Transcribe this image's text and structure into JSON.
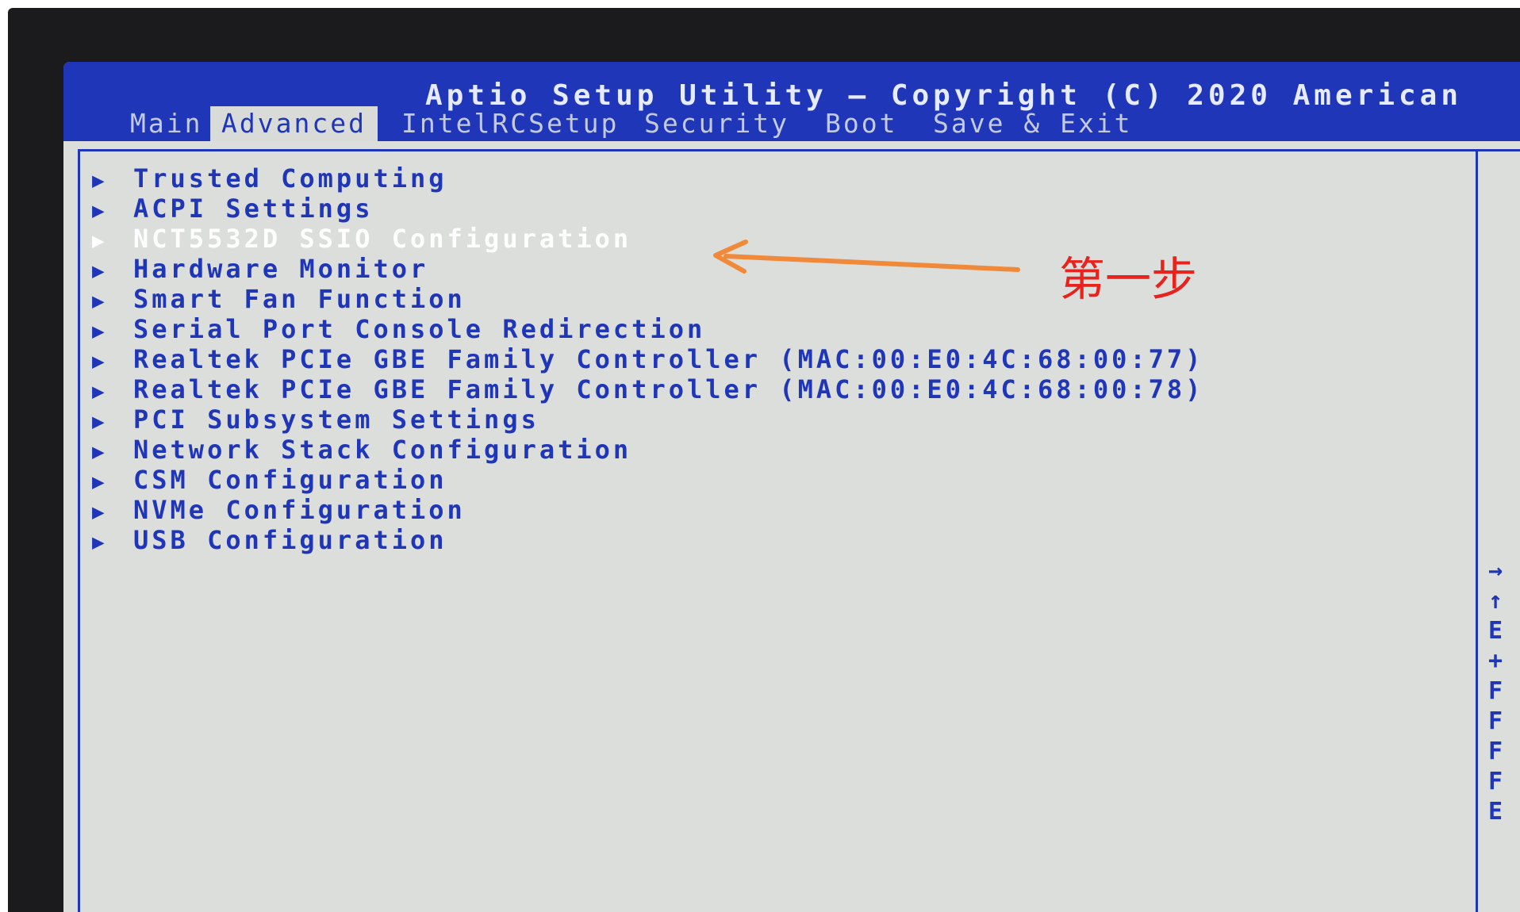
{
  "title": "Aptio Setup Utility – Copyright (C) 2020 American",
  "tabs": [
    {
      "label": "Main"
    },
    {
      "label": "Advanced"
    },
    {
      "label": "IntelRCSetup"
    },
    {
      "label": "Security"
    },
    {
      "label": "Boot"
    },
    {
      "label": "Save & Exit"
    }
  ],
  "active_tab": "Advanced",
  "menu": {
    "items": [
      {
        "label": "Trusted Computing"
      },
      {
        "label": "ACPI Settings"
      },
      {
        "label": "NCT5532D SSIO Configuration"
      },
      {
        "label": "Hardware Monitor"
      },
      {
        "label": "Smart Fan Function"
      },
      {
        "label": "Serial Port Console Redirection"
      },
      {
        "label": "Realtek PCIe GBE Family Controller (MAC:00:E0:4C:68:00:77)"
      },
      {
        "label": "Realtek PCIe GBE Family Controller (MAC:00:E0:4C:68:00:78)"
      },
      {
        "label": "PCI Subsystem Settings"
      },
      {
        "label": "Network Stack Configuration"
      },
      {
        "label": "CSM Configuration"
      },
      {
        "label": "NVMe Configuration"
      },
      {
        "label": "USB Configuration"
      }
    ],
    "selected": "NCT5532D SSIO Configuration"
  },
  "help_keys": [
    "→",
    "↑",
    "E",
    "+",
    "F",
    "F",
    "F",
    "F",
    "E"
  ],
  "annotation": {
    "text": "第一步"
  },
  "colors": {
    "title_bar": "#1f36b8",
    "background": "#dcdedb",
    "menu_text": "#1f36b8",
    "selected_text": "#ffffff",
    "annotation": "#e8231e",
    "annotation_arrow": "#f08a3a"
  }
}
